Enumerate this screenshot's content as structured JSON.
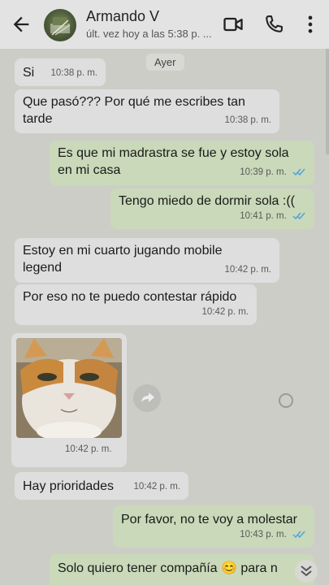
{
  "header": {
    "contact_name": "Armando V",
    "last_seen": "últ. vez hoy a las 5:38 p. ..."
  },
  "chat": {
    "date_chip": "Ayer",
    "messages": [
      {
        "dir": "in",
        "text": "Si",
        "time": "10:38 p. m."
      },
      {
        "dir": "in",
        "text": "Que pasó??? Por qué me escribes tan tarde",
        "time": "10:38 p. m."
      },
      {
        "dir": "out",
        "text": "Es que mi madrastra se fue y estoy sola en mi casa",
        "time": "10:39 p. m.",
        "read": true
      },
      {
        "dir": "out",
        "text": "Tengo miedo de dormir sola :((",
        "time": "10:41 p. m.",
        "read": true
      },
      {
        "dir": "in",
        "text": "Estoy en mi cuarto jugando mobile legend",
        "time": "10:42 p. m."
      },
      {
        "dir": "in",
        "text": "Por eso no te puedo contestar rápido",
        "time": "10:42 p. m."
      },
      {
        "dir": "in",
        "type": "image",
        "image_desc": "cat photo",
        "time": "10:42 p. m."
      },
      {
        "dir": "in",
        "text": "Hay prioridades",
        "time": "10:42 p. m."
      },
      {
        "dir": "out",
        "text": "Por favor, no te voy a molestar",
        "time": "10:43 p. m.",
        "read": true
      },
      {
        "dir": "out",
        "text": "Solo quiero tener compañía 😊 para n",
        "time": "",
        "read": false
      }
    ]
  },
  "colors": {
    "incoming_bubble": "#dedede",
    "outgoing_bubble": "#c9d9b9",
    "read_ticks": "#4fa3e0"
  },
  "icons": [
    "back-arrow-icon",
    "video-call-icon",
    "phone-icon",
    "more-vert-icon",
    "forward-icon",
    "chevron-down-icon"
  ]
}
